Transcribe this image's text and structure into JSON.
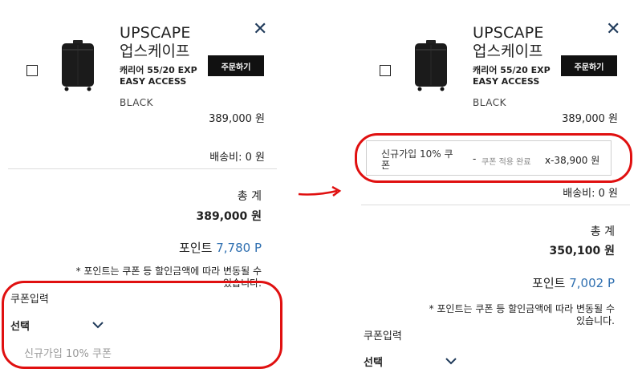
{
  "left": {
    "brand_en": "UPSCAPE",
    "brand_ko": "업스케이프",
    "model_line1": "캐리어 55/20 EXP",
    "model_line2": "EASY ACCESS",
    "color": "BLACK",
    "order_button": "주문하기",
    "price": "389,000 원",
    "shipping": "배송비: 0 원",
    "total_label": "총 계",
    "total_value": "389,000 원",
    "points_label": "포인트",
    "points_value": "7,780 P",
    "notice_line1": "* 포인트는 쿠폰 등 할인금액에 따라 변동될 수",
    "notice_line2": "있습니다.",
    "coupon_title": "쿠폰입력",
    "select_label": "선택",
    "coupon_option": "신규가입 10% 쿠폰"
  },
  "right": {
    "brand_en": "UPSCAPE",
    "brand_ko": "업스케이프",
    "model_line1": "캐리어 55/20 EXP",
    "model_line2": "EASY ACCESS",
    "color": "BLACK",
    "order_button": "주문하기",
    "price": "389,000 원",
    "coupon_name_line1": "신규가입 10% 쿠",
    "coupon_name_line2": "폰",
    "coupon_dash": "-",
    "coupon_status": "쿠폰 적용 완료",
    "coupon_amount": "x-38,900 원",
    "shipping": "배송비: 0 원",
    "total_label": "총 계",
    "total_value": "350,100 원",
    "points_label": "포인트",
    "points_value": "7,002 P",
    "notice_line1": "* 포인트는 쿠폰 등 할인금액에 따라 변동될 수",
    "notice_line2": "있습니다.",
    "coupon_title": "쿠폰입력",
    "select_label": "선택"
  },
  "colors": {
    "highlight": "#e01010",
    "points": "#2f6fb0",
    "close_icon": "#1f3a5a"
  },
  "icons": [
    "close-icon",
    "chevron-down-icon",
    "suitcase-image",
    "right-arrow-icon"
  ]
}
